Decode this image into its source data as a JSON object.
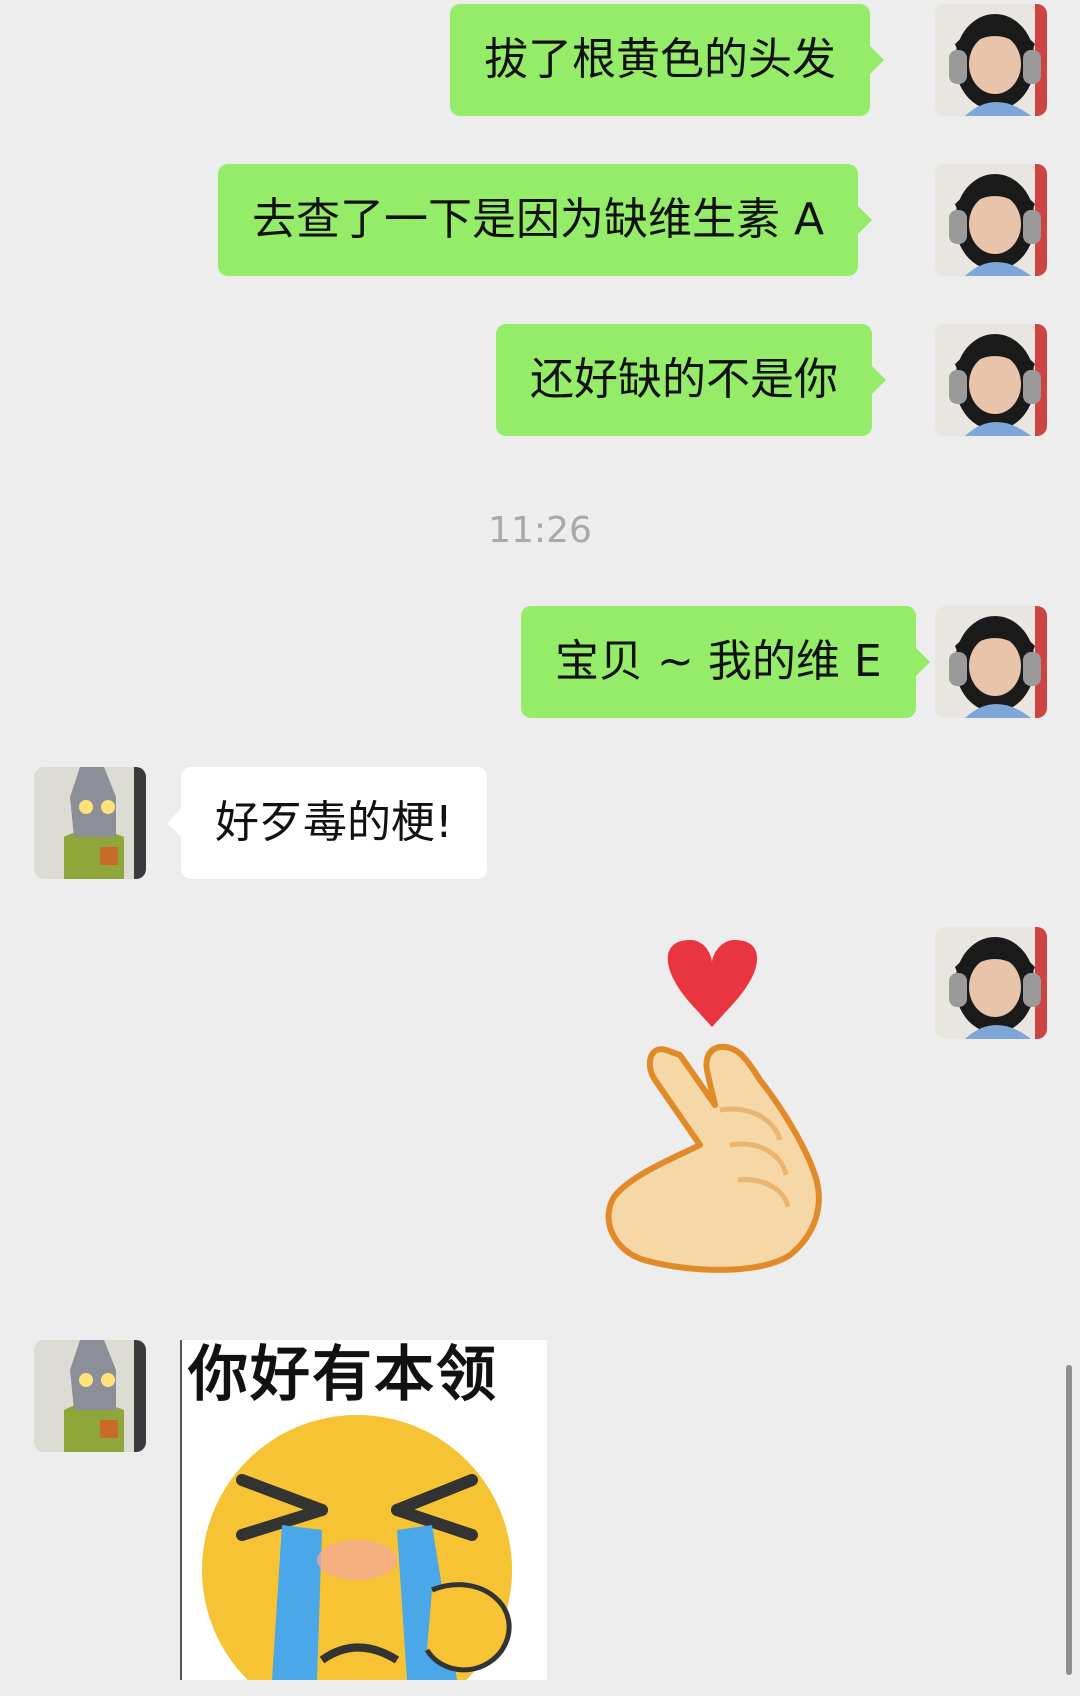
{
  "messages": [
    {
      "side": "right",
      "text": "拔了根黄色的头发"
    },
    {
      "side": "right",
      "text": "去查了一下是因为缺维生素 A"
    },
    {
      "side": "right",
      "text": "还好缺的不是你"
    },
    {
      "side": "right",
      "text": "宝贝 ~ 我的维 E"
    },
    {
      "side": "left",
      "text": "好歹毒的梗!"
    }
  ],
  "timestamp": "11:26",
  "sticker_heart": {
    "icon": "finger-heart-sticker",
    "colors": {
      "heart": "#e8353f",
      "hand": "#f6d8a6",
      "outline": "#e08a2a"
    }
  },
  "meme": {
    "caption": "你好有本领",
    "icon": "crying-emoji-sticker"
  },
  "colors": {
    "background": "#ededed",
    "my_bubble": "#95ec69",
    "their_bubble": "#ffffff",
    "timestamp": "#a9a9a9"
  }
}
